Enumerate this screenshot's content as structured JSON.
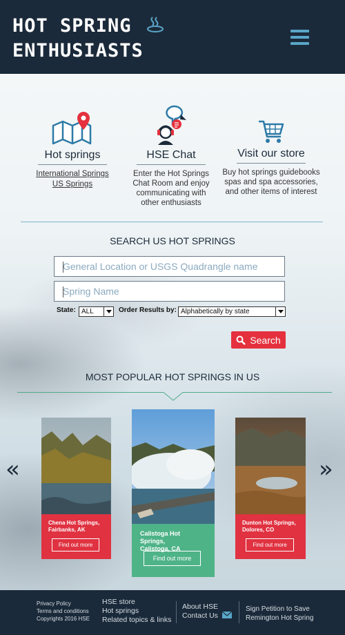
{
  "header": {
    "logo_line1": "HOT SPRING",
    "logo_line2": "ENTHUSIASTS"
  },
  "features": [
    {
      "title": "Hot springs",
      "links": [
        "International Springs",
        "US Springs"
      ]
    },
    {
      "title": "HSE Chat",
      "description": "Enter the Hot Springs Chat Room and enjoy communicating with other enthusiasts"
    },
    {
      "title": "Visit our store",
      "description": "Buy hot springs guidebooks spas and spa accessories, and other items of interest"
    }
  ],
  "search": {
    "title": "SEARCH US HOT SPRINGS",
    "location_placeholder": "General Location or USGS Quadrangle name",
    "name_placeholder": "Spring Name",
    "state_label": "State:",
    "state_value": "ALL",
    "order_label": "Order Results by:",
    "order_value": "Alphabetically by state",
    "button_label": "Search"
  },
  "popular": {
    "title": "MOST POPULAR  HOT SPRINGS IN US",
    "cards": [
      {
        "name_line1": "Chena Hot Springs,",
        "name_line2": "Fairbanks, AK",
        "button": "Find out more",
        "color": "#e03241"
      },
      {
        "name_line1": "Calistoga Hot Springs,",
        "name_line2": "Calistoga, CA",
        "button": "Find out more",
        "color": "#4fb388"
      },
      {
        "name_line1": "Dunton Hot Springs,",
        "name_line2": "Dolores, CO",
        "button": "Find out more",
        "color": "#e03241"
      }
    ],
    "prev_icon": "«",
    "next_icon": "»"
  },
  "footer": {
    "privacy": "Privacy Policy",
    "terms": "Terms and conditions",
    "copyright": "Copyrights 2016  HSE",
    "store": "HSE store",
    "hot_springs": "Hot springs",
    "related": "Related topics & links",
    "about": "About HSE",
    "contact": "Contact Us",
    "petition_line1": "Sign Petition to Save",
    "petition_line2": "Remington Hot Spring"
  },
  "colors": {
    "navy": "#1b2a3a",
    "accent_blue": "#5aa6c9",
    "red": "#e4313d",
    "green": "#4fb388"
  }
}
